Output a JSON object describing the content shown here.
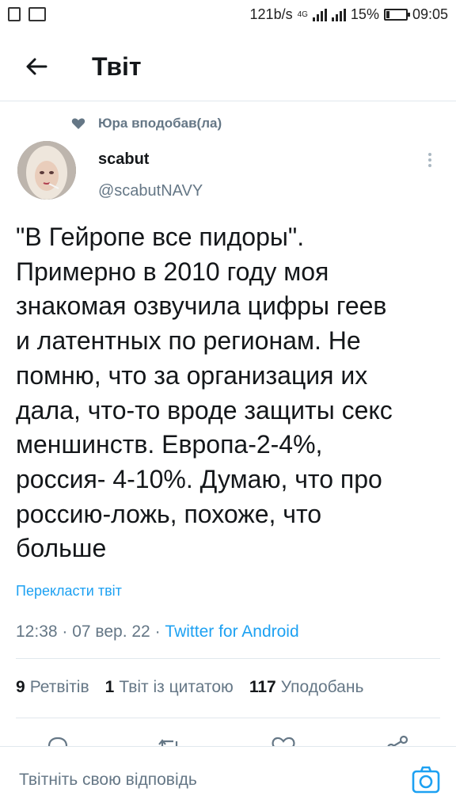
{
  "status_bar": {
    "speed": "121b/s",
    "network": "4G",
    "battery_percent": "15%",
    "battery_level": 0.15,
    "time": "09:05"
  },
  "header": {
    "title": "Твіт"
  },
  "social_context": {
    "text": "Юра вподобав(ла)"
  },
  "author": {
    "name": "scabut",
    "handle": "@scabutNAVY"
  },
  "tweet": {
    "text": "\"В Гейропе все пидоры\".\nПримерно в 2010 году моя\nзнакомая озвучила цифры геев\nи латентных по регионам. Не\nпомню, что за организация их\nдала, что-то вроде защиты секс\nменшинств. Европа-2-4%,\nроссия- 4-10%. Думаю, что про\nроссию-ложь, похоже, что\nбольше",
    "translate_label": "Перекласти твіт",
    "time": "12:38",
    "date": "07 вер. 22",
    "source": "Twitter for Android"
  },
  "stats": {
    "retweets_count": "9",
    "retweets_label": "Ретвітів",
    "quotes_count": "1",
    "quotes_label": "Твіт із цитатою",
    "likes_count": "117",
    "likes_label": "Уподобань"
  },
  "reply": {
    "placeholder": "Твітніть свою відповідь"
  },
  "icons": {
    "back": "arrow-left-icon",
    "heart": "heart-icon",
    "more": "more-vertical-icon",
    "camera": "camera-icon"
  },
  "colors": {
    "accent": "#1da1f2",
    "secondary_text": "#657786",
    "primary_text": "#14171a",
    "divider": "#e1e8ed"
  }
}
